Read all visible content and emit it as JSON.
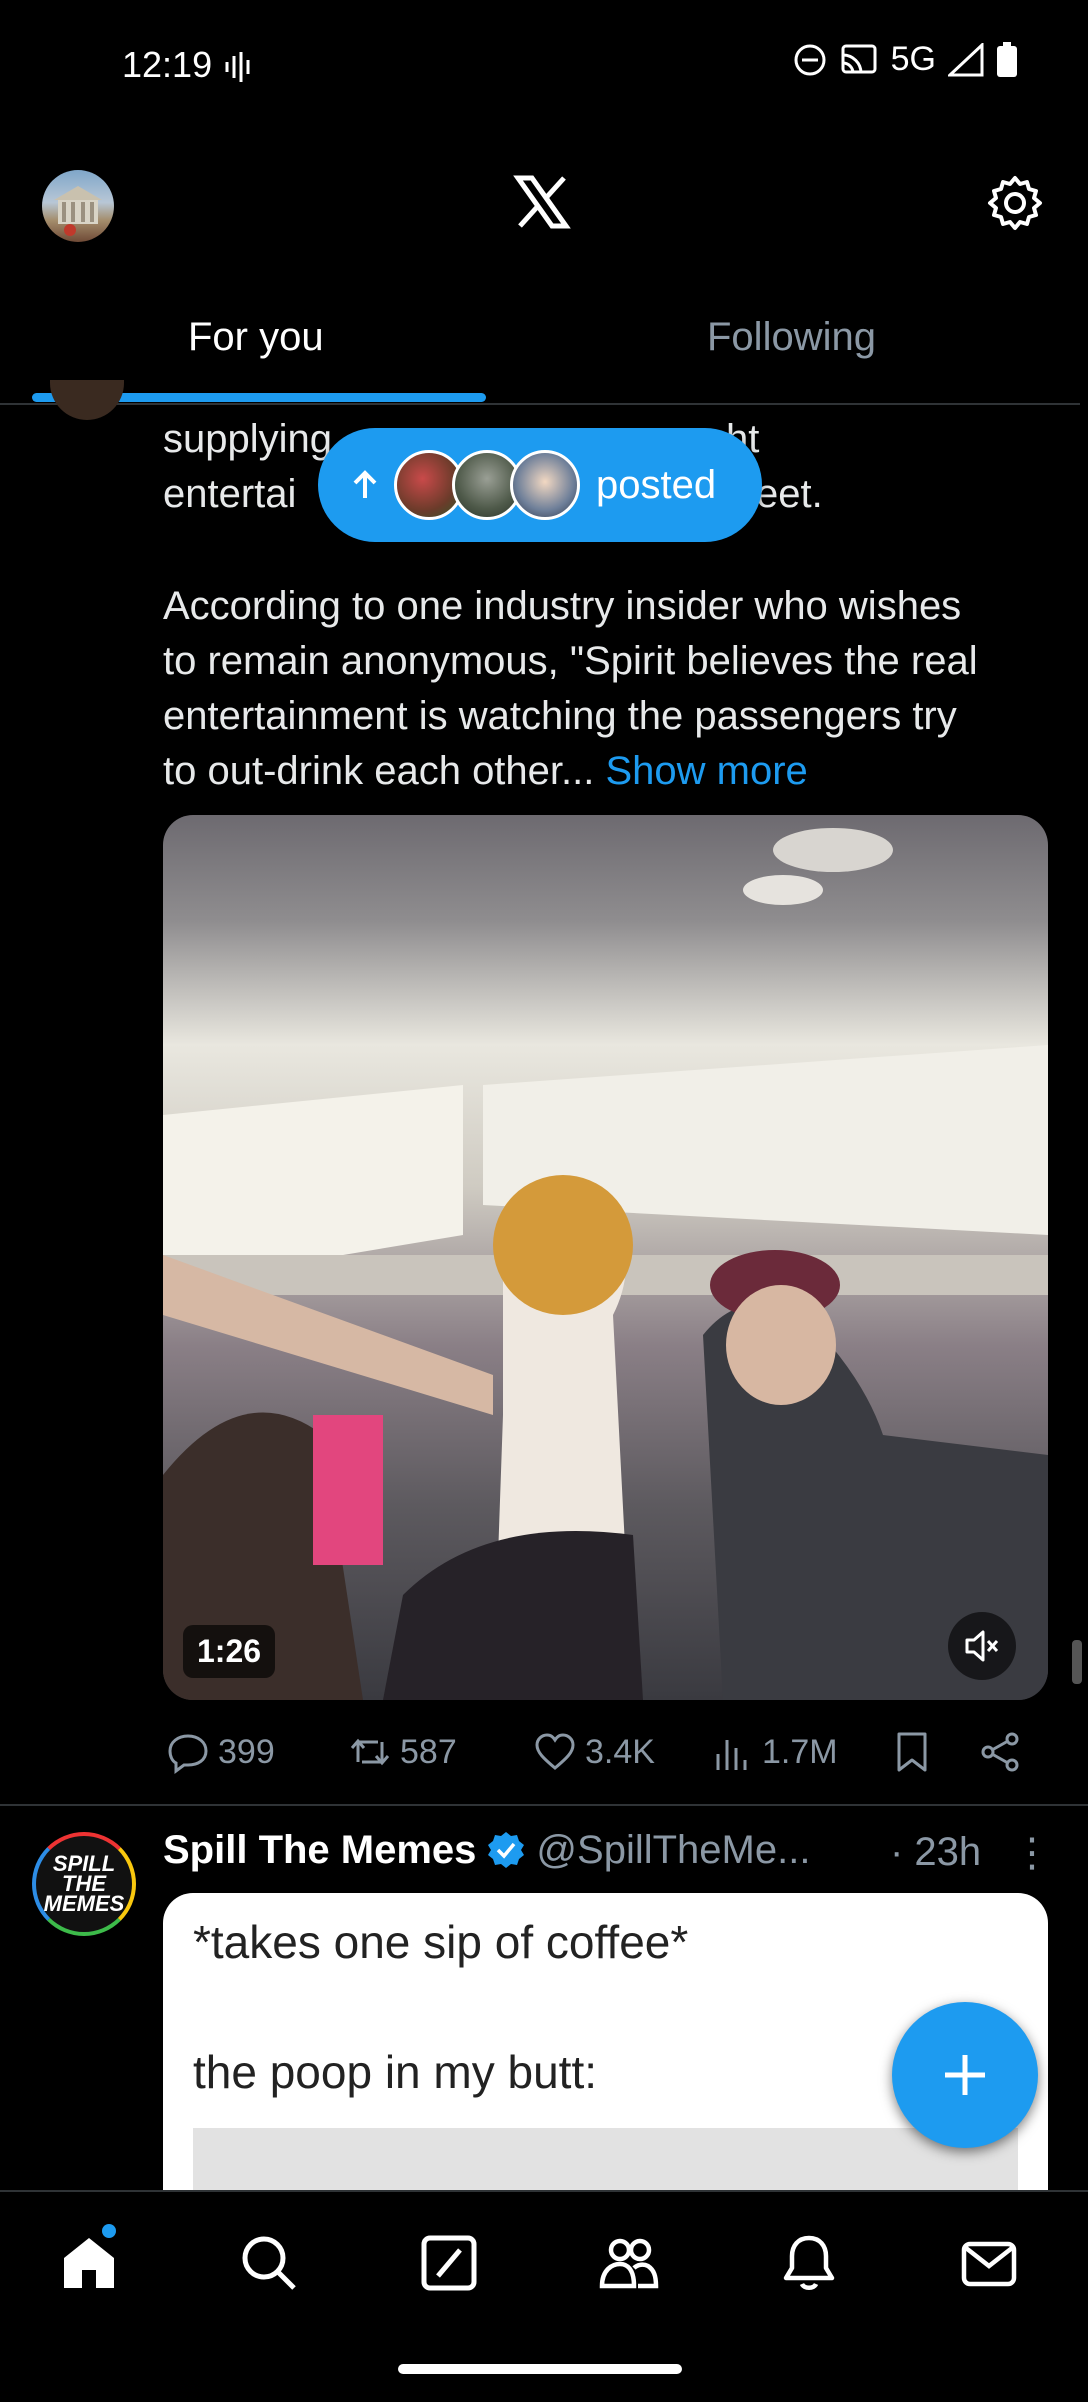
{
  "status_bar": {
    "time": "12:19",
    "network": "5G"
  },
  "header": {
    "avatar_icon": "profile-avatar",
    "logo_icon": "x-logo-icon",
    "settings_icon": "gear-icon"
  },
  "tabs": [
    {
      "label": "For you",
      "active": true
    },
    {
      "label": "Following",
      "active": false
    }
  ],
  "tweet": {
    "partial_line_1": "supplying",
    "partial_line_1b": "ht",
    "partial_line_2": "entertai",
    "partial_line_2b": "eet.",
    "paragraph_lines": [
      "According to one industry insider who wishes",
      "to remain anonymous, \"Spirit believes the real",
      "entertainment is watching the passengers try",
      "to out-drink each other..."
    ],
    "show_more": "Show more",
    "video": {
      "duration": "1:26",
      "muted": true
    },
    "actions": {
      "replies": "399",
      "reposts": "587",
      "likes": "3.4K",
      "views": "1.7M"
    }
  },
  "new_posts_pill": {
    "label": "posted"
  },
  "next_tweet": {
    "name": "Spill The Memes",
    "handle": "@SpillTheMe...",
    "time": "· 23h",
    "more": "⋮",
    "avatar_text": "SPILL THE MEMES",
    "meme_line_1": "*takes one sip of coffee*",
    "meme_line_2": "the poop in my butt:"
  },
  "colors": {
    "accent": "#1d9bf0",
    "background": "#000000",
    "text": "#e7e9ea",
    "muted": "#8b98a5"
  },
  "bottom_nav": [
    "home-icon",
    "search-icon",
    "grok-icon",
    "communities-icon",
    "notifications-icon",
    "messages-icon"
  ]
}
